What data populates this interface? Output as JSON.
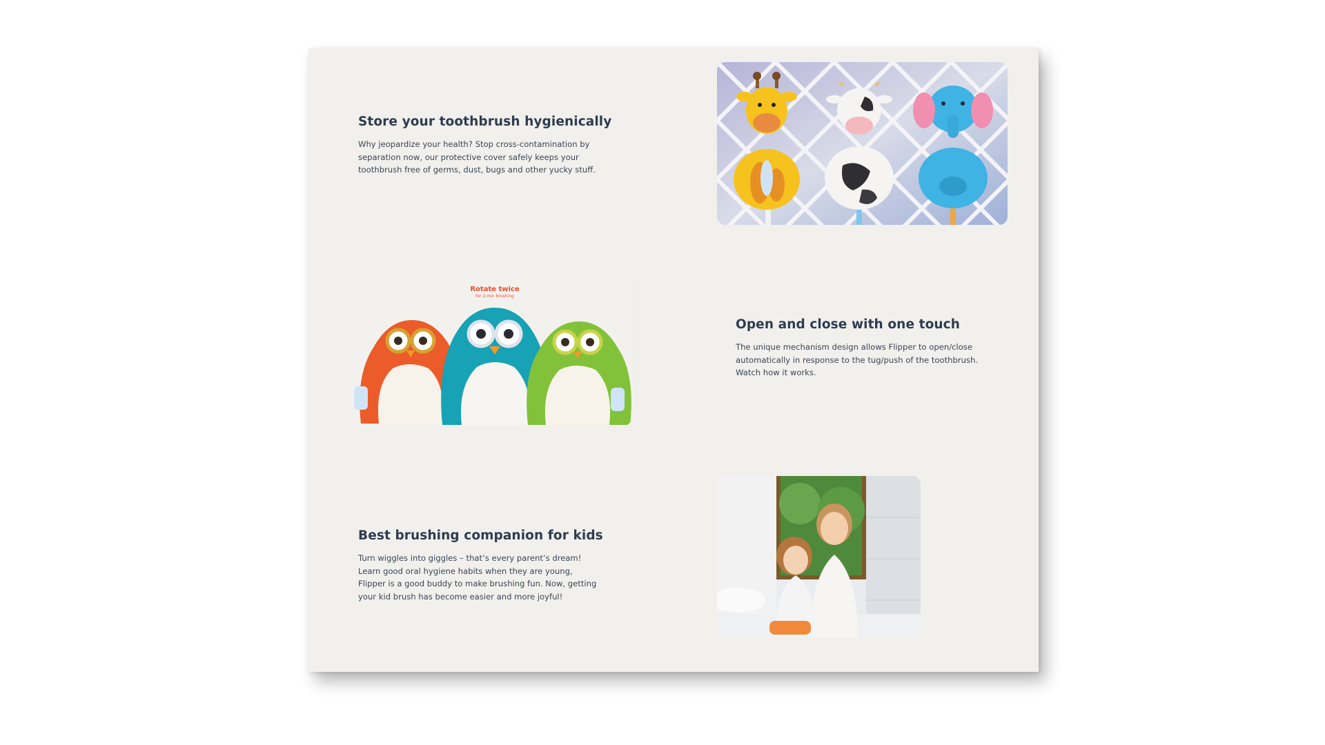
{
  "features": [
    {
      "title": "Store your toothbrush hygienically",
      "body": "Why jeopardize your health? Stop cross-contamination by separation now, our protective cover safely keeps your toothbrush free of germs, dust, bugs and other yucky stuff."
    },
    {
      "title": "Open and close with one touch",
      "body": "The unique mechanism design allows Flipper to open/close automatically in response to the tug/push of the toothbrush. Watch how it works."
    },
    {
      "title": "Best brushing companion for kids",
      "body": "Turn wiggles into giggles – that’s every parent’s dream! Learn good oral hygiene habits when they are young, Flipper is a good buddy to make brushing fun. Now, getting your kid brush has become easier and more joyful!"
    }
  ],
  "owl_image": {
    "caption": "Rotate twice",
    "subcaption": "for 2-min brushing"
  },
  "colors": {
    "panel_bg": "#f1f0ec",
    "heading": "#2f3b4f",
    "body_text": "#3a4556",
    "accent_red": "#e94d2c"
  }
}
